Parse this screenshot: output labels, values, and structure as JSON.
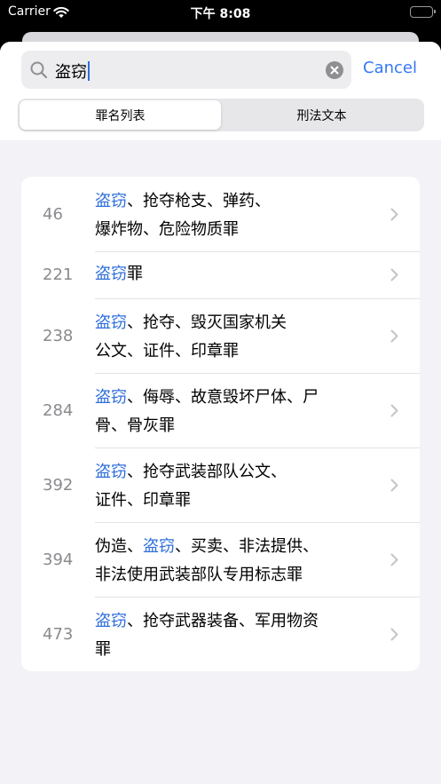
{
  "status_bar": {
    "carrier": "Carrier",
    "time": "下午 8:08"
  },
  "search": {
    "query": "盗窃",
    "cancel_label": "Cancel"
  },
  "segments": [
    {
      "label": "罪名列表",
      "selected": true
    },
    {
      "label": "刑法文本",
      "selected": false
    }
  ],
  "highlight_term": "盗窃",
  "highlight_color": "#2f6fdb",
  "results": [
    {
      "number": "46",
      "title": "盗窃、抢夺枪支、弹药、\n爆炸物、危险物质罪"
    },
    {
      "number": "221",
      "title": "盗窃罪"
    },
    {
      "number": "238",
      "title": "盗窃、抢夺、毁灭国家机关\n公文、证件、印章罪"
    },
    {
      "number": "284",
      "title": "盗窃、侮辱、故意毁坏尸体、尸\n骨、骨灰罪"
    },
    {
      "number": "392",
      "title": "盗窃、抢夺武装部队公文、\n证件、印章罪"
    },
    {
      "number": "394",
      "title": "伪造、盗窃、买卖、非法提供、\n非法使用武装部队专用标志罪"
    },
    {
      "number": "473",
      "title": "盗窃、抢夺武器装备、军用物资\n罪"
    }
  ]
}
